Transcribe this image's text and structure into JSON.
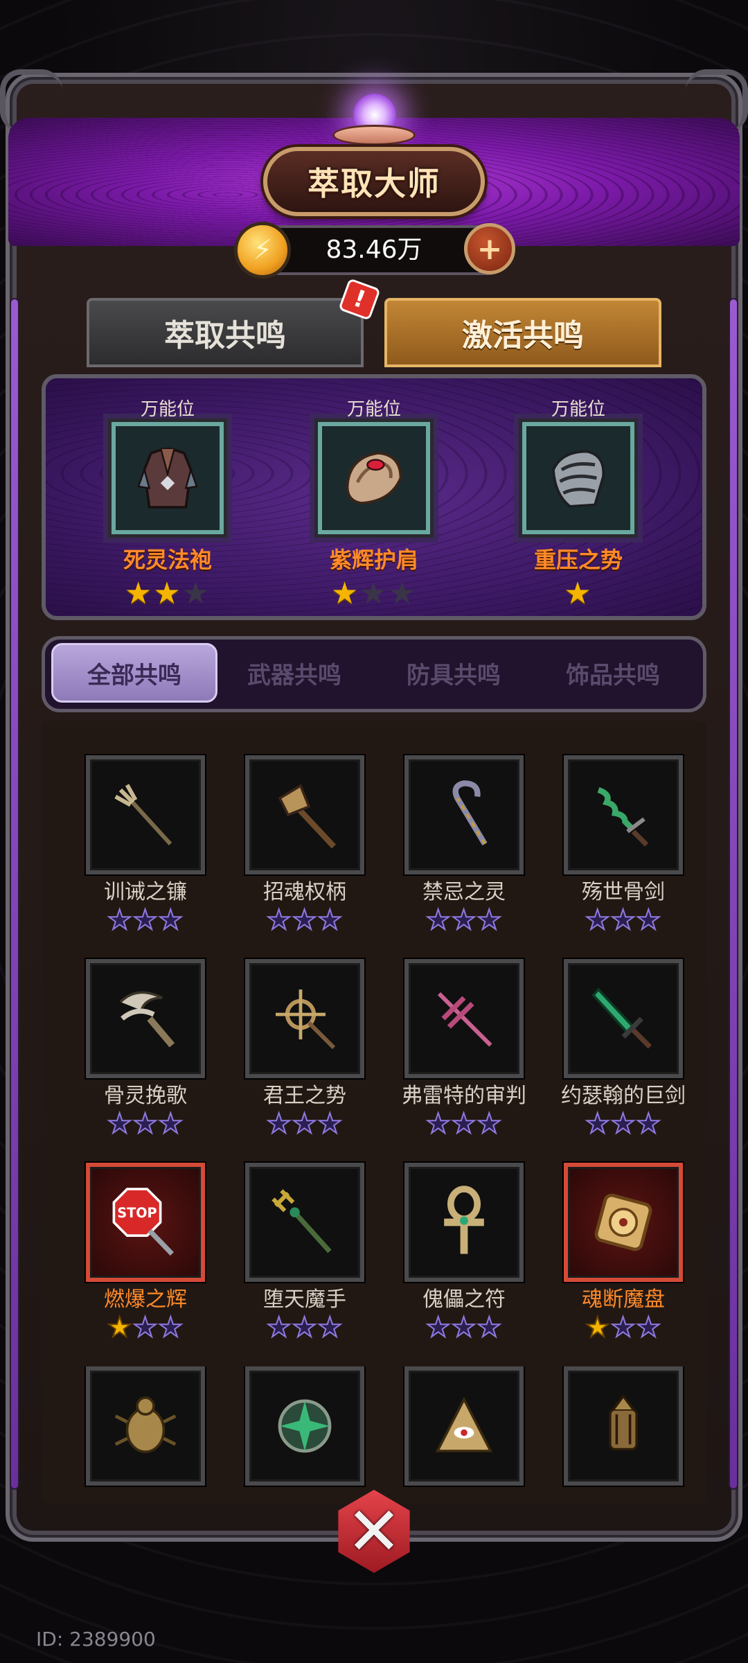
{
  "header": {
    "title": "萃取大师",
    "currency_value": "83.46万",
    "coin_icon": "gold-coin-icon",
    "plus_icon": "plus-icon"
  },
  "top_tabs": [
    {
      "label": "萃取共鸣",
      "active": false,
      "alert": "!"
    },
    {
      "label": "激活共鸣",
      "active": true
    }
  ],
  "slots": [
    {
      "caption": "万能位",
      "name": "死灵法袍",
      "stars": 2,
      "max_stars": 3,
      "icon": "armor-robe-icon"
    },
    {
      "caption": "万能位",
      "name": "紫辉护肩",
      "stars": 1,
      "max_stars": 3,
      "icon": "shoulder-guard-icon"
    },
    {
      "caption": "万能位",
      "name": "重压之势",
      "stars": 1,
      "max_stars": 1,
      "icon": "plate-armor-icon"
    }
  ],
  "filters": [
    {
      "label": "全部共鸣",
      "active": true
    },
    {
      "label": "武器共鸣",
      "active": false
    },
    {
      "label": "防具共鸣",
      "active": false
    },
    {
      "label": "饰品共鸣",
      "active": false
    }
  ],
  "items": [
    {
      "name": "训诫之镰",
      "stars": 0,
      "icon": "trident-staff-icon",
      "highlight": false
    },
    {
      "name": "招魂权柄",
      "stars": 0,
      "icon": "claw-scepter-icon",
      "highlight": false
    },
    {
      "name": "禁忌之灵",
      "stars": 0,
      "icon": "crook-staff-icon",
      "highlight": false
    },
    {
      "name": "殇世骨剑",
      "stars": 0,
      "icon": "wavy-sword-icon",
      "highlight": false
    },
    {
      "name": "骨灵挽歌",
      "stars": 0,
      "icon": "bone-scythe-icon",
      "highlight": false
    },
    {
      "name": "君王之势",
      "stars": 0,
      "icon": "compass-spear-icon",
      "highlight": false
    },
    {
      "name": "弗雷特的审判",
      "stars": 0,
      "icon": "crossed-spear-icon",
      "highlight": false
    },
    {
      "name": "约瑟翰的巨剑",
      "stars": 0,
      "icon": "jade-greatsword-icon",
      "highlight": false
    },
    {
      "name": "燃爆之辉",
      "stars": 1,
      "icon": "stop-sign-icon",
      "highlight": true
    },
    {
      "name": "堕天魔手",
      "stars": 0,
      "icon": "golden-trident-icon",
      "highlight": false
    },
    {
      "name": "傀儡之符",
      "stars": 0,
      "icon": "ankh-icon",
      "highlight": false
    },
    {
      "name": "魂断魔盘",
      "stars": 1,
      "icon": "golden-disc-icon",
      "highlight": true
    },
    {
      "name": "",
      "stars": 0,
      "icon": "scarab-icon",
      "highlight": false
    },
    {
      "name": "",
      "stars": 0,
      "icon": "green-emblem-icon",
      "highlight": false
    },
    {
      "name": "",
      "stars": 0,
      "icon": "eye-pyramid-icon",
      "highlight": false
    },
    {
      "name": "",
      "stars": 0,
      "icon": "lantern-icon",
      "highlight": false
    }
  ],
  "close_icon": "close-x-icon",
  "footer": {
    "user_id": "ID: 2389900"
  },
  "colors": {
    "accent_orange": "#ff8a2a",
    "star_gold": "#f5b400",
    "banner_purple": "#7b1aa8",
    "alert_red": "#e0302a"
  }
}
